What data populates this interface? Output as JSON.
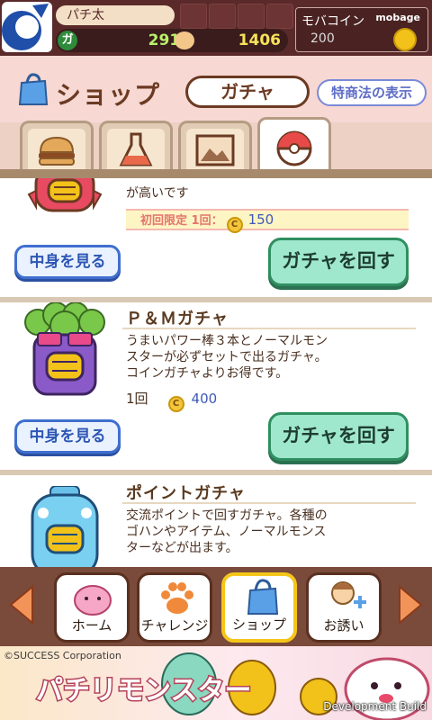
{
  "status": {
    "player_name": "パチ太",
    "gacha_points": "2910",
    "friend_points": "1406",
    "mobacoin_label": "モバコイン",
    "mobacoin_brand": "mobage",
    "mobacoin_value": "200"
  },
  "header": {
    "title": "ショップ",
    "active_tab": "ガチャ",
    "law_button": "特商法の表示"
  },
  "category_tabs": [
    {
      "icon": "hamburger-icon"
    },
    {
      "icon": "flask-icon"
    },
    {
      "icon": "picture-icon"
    },
    {
      "icon": "capsule-icon",
      "active": true
    }
  ],
  "items": [
    {
      "desc_tail": "が高いです",
      "first_limited_label": "初回限定 1回：",
      "first_limited_price": "150",
      "view_label": "中身を見る",
      "spin_label": "ガチャを回す"
    },
    {
      "title": "Ｐ＆Ｍガチャ",
      "desc": "うまいパワー棒３本とノーマルモン\nスターが必ずセットで出るガチャ。\nコインガチャよりお得です。",
      "price_label": "1回",
      "price": "400",
      "view_label": "中身を見る",
      "spin_label": "ガチャを回す"
    },
    {
      "title": "ポイントガチャ",
      "desc": "交流ポイントで回すガチャ。各種の\nゴハンやアイテム、ノーマルモンス\nターなどが出ます。"
    }
  ],
  "coin_symbol": "C",
  "nav": [
    {
      "label": "ホーム",
      "icon": "pink-blob-icon"
    },
    {
      "label": "チャレンジ",
      "icon": "paw-icon"
    },
    {
      "label": "ショップ",
      "icon": "shopping-bag-icon",
      "active": true
    },
    {
      "label": "お誘い",
      "icon": "invite-friend-icon"
    }
  ],
  "banner": {
    "copyright": "©SUCCESS Corporation",
    "title": "パチリモンスター",
    "dev_build": "Development Build"
  },
  "colors": {
    "top_bar": "#5a2a2a",
    "header_pink": "#f7d8d3",
    "nav_brown": "#7a4a3a",
    "accent_green": "#9fe8cd",
    "accent_blue": "#3f6fd0"
  }
}
